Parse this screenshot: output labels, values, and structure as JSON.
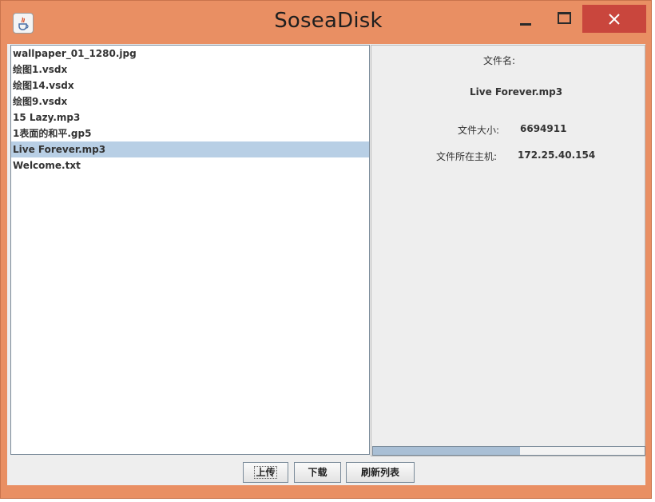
{
  "window": {
    "title": "SoseaDisk",
    "icon": "java-cup-icon"
  },
  "files": [
    "wallpaper_01_1280.jpg",
    "绘图1.vsdx",
    "绘图14.vsdx",
    "绘图9.vsdx",
    "15 Lazy.mp3",
    "1表面的和平.gp5",
    "Live Forever.mp3",
    "Welcome.txt"
  ],
  "selected_index": 6,
  "info": {
    "name_label": "文件名:",
    "name_value": "Live Forever.mp3",
    "size_label": "文件大小:",
    "size_value": "6694911",
    "host_label": "文件所在主机:",
    "host_value": "172.25.40.154"
  },
  "progress": {
    "fraction": 0.54
  },
  "buttons": {
    "upload": "上传",
    "download": "下载",
    "refresh": "刷新列表"
  },
  "colors": {
    "frame": "#e98f63",
    "close": "#c9463d",
    "selection": "#b8cfe5",
    "progress": "#a9bfd5"
  }
}
